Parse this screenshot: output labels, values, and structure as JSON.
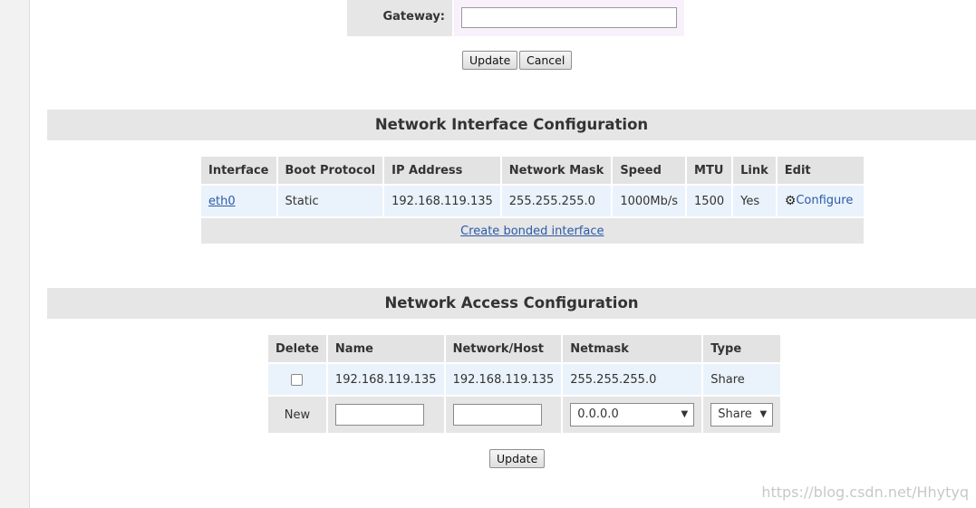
{
  "gateway": {
    "label": "Gateway:",
    "value": ""
  },
  "top_buttons": {
    "update": "Update",
    "cancel": "Cancel"
  },
  "interfaces": {
    "title": "Network Interface Configuration",
    "headers": [
      "Interface",
      "Boot Protocol",
      "IP Address",
      "Network Mask",
      "Speed",
      "MTU",
      "Link",
      "Edit"
    ],
    "row": {
      "interface": "eth0",
      "boot_protocol": "Static",
      "ip_address": "192.168.119.135",
      "network_mask": "255.255.255.0",
      "speed": "1000Mb/s",
      "mtu": "1500",
      "link": "Yes",
      "edit_icon": "gear-icon",
      "edit_label": "Configure"
    },
    "create_bonded": "Create bonded interface"
  },
  "access": {
    "title": "Network Access Configuration",
    "headers": [
      "Delete",
      "Name",
      "Network/Host",
      "Netmask",
      "Type"
    ],
    "row": {
      "name": "192.168.119.135",
      "network_host": "192.168.119.135",
      "netmask": "255.255.255.0",
      "type": "Share"
    },
    "new_row": {
      "label": "New",
      "name_value": "",
      "network_value": "",
      "netmask_selected": "0.0.0.0",
      "type_selected": "Share"
    },
    "update": "Update"
  },
  "watermark": "https://blog.csdn.net/Hhytyq"
}
